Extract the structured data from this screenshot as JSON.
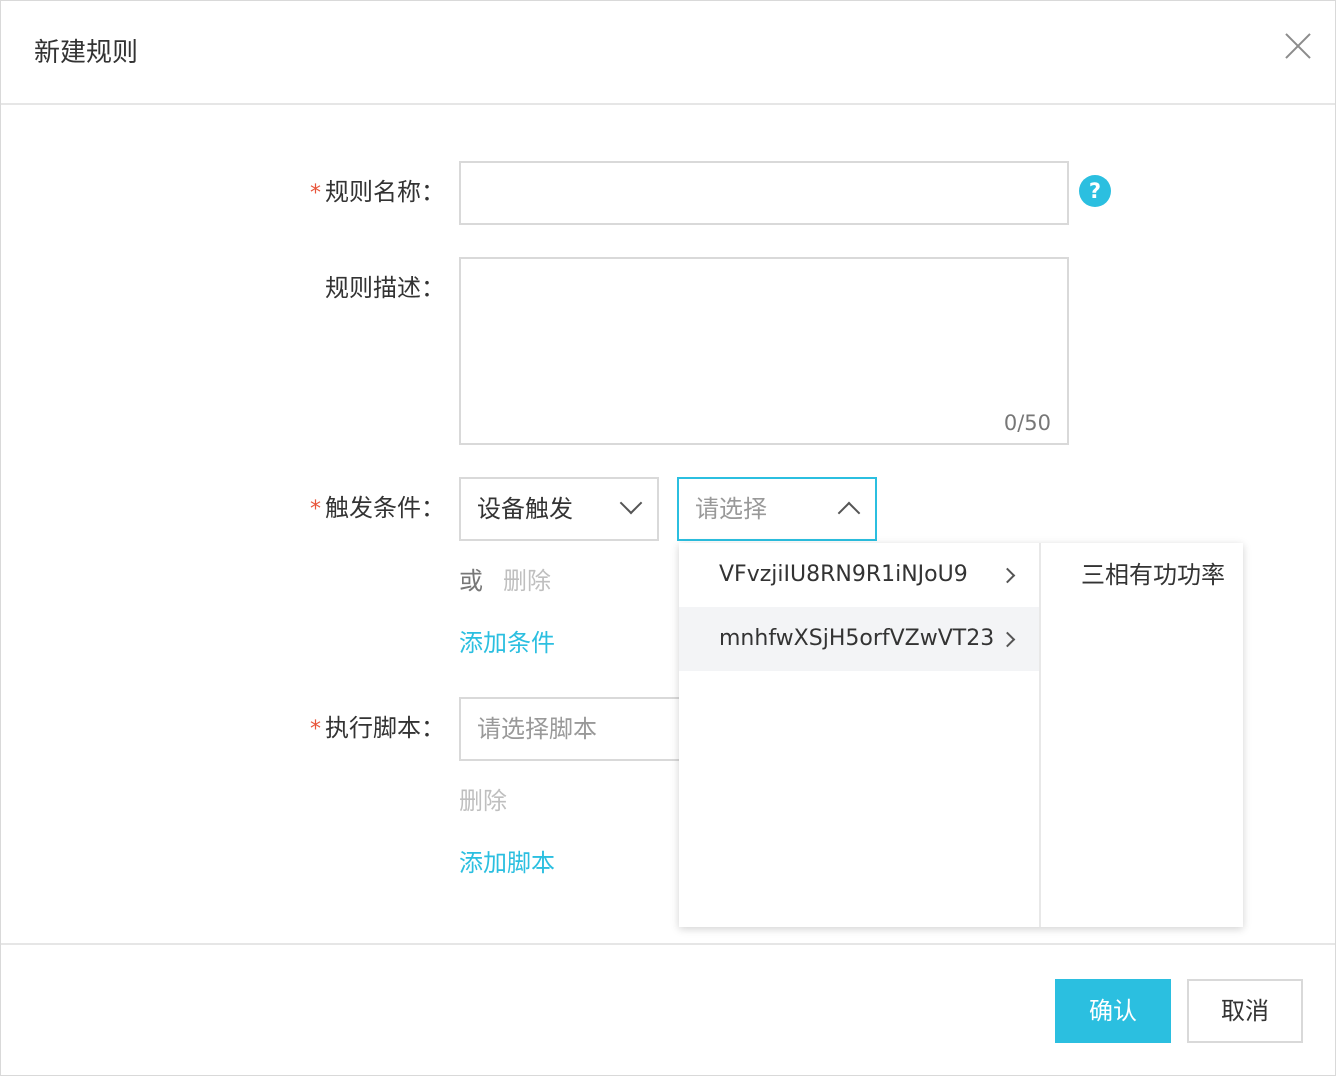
{
  "dialog": {
    "title": "新建规则"
  },
  "form": {
    "required_mark": "*",
    "rule_name": {
      "label": "规则名称：",
      "value": ""
    },
    "rule_desc": {
      "label": "规则描述：",
      "value": "",
      "counter": "0/50"
    },
    "trigger": {
      "label": "触发条件：",
      "type_value": "设备触发",
      "device_placeholder": "请选择",
      "or_text": "或",
      "delete_text": "删除",
      "add_text": "添加条件"
    },
    "script": {
      "label": "执行脚本：",
      "placeholder": "请选择脚本",
      "delete_text": "删除",
      "add_text": "添加脚本"
    }
  },
  "cascader": {
    "level1": [
      {
        "label": "VFvzjiIU8RN9R1iNJoU9",
        "hovered": false
      },
      {
        "label": "mnhfwXSjH5orfVZwVT23",
        "hovered": true
      }
    ],
    "level2": [
      {
        "label": "三相有功功率"
      }
    ]
  },
  "footer": {
    "confirm": "确认",
    "cancel": "取消"
  },
  "colors": {
    "accent": "#2bbfe0",
    "required": "#e8553b",
    "border": "#d9d9d9"
  }
}
